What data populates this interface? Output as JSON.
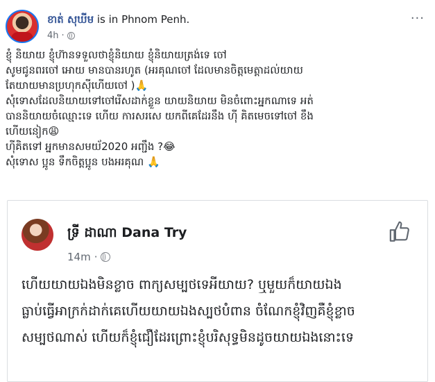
{
  "post": {
    "author": "ខាត់ សុឃីម",
    "author_suffix": " is in Phnom Penh.",
    "time": "4h",
    "time_separator": "·",
    "more": "···",
    "body_lines": [
      "ខ្ញុំ និយាយ ខ្ញុំហ៊ានទទួលថាខ្ញុំនិយាយ ខ្ញុំនិយាយត្រង់ទេ ចៅ",
      "សូមជូនពរចៅ អោយ មានបានរហូត (អរគុណចៅ ដែលមានចិត្តមេត្តាដល់យាយ",
      "តែយាយមានប្រហុកស៊ីហើយចៅ )🙏",
      "សុំទោសដែលនិយាយទៅចៅរើសដាក់ខ្លួន យាយនិយាយ មិនចំពោះអ្នកណាទេ អត់",
      "បាននិយាយចំឈ្មោះទេ ហើយ ការសរសេ យកពីគេដែរនឹង ហ៊ី គិតមេចទៅចៅ ខឹង",
      "ហើយនៀក😩",
      "ហ៊ីគិតទៅ អ្នកមានសមយ័2020 អញ្ជឹង ?😂",
      "សុំទោស ប្អូន ទឹកចិត្តប្អូន បងអរគុណ 🙏"
    ]
  },
  "shared": {
    "author": "ទ្រី ដាណា Dana Try",
    "time": "14m",
    "time_separator": "·",
    "lines": [
      "ហើយយាយឯងមិនខ្លាច ពាក្យសម្បថទេអីយាយ? ឬមួយក៏យាយឯង",
      "ធ្លាប់ធ្វើអាក្រក់ដាក់គេហើយយាយឯងស្បថបំពាន ចំណែកខ្ញុំវិញគឺខ្ញុំខ្លាច",
      "សម្បថណាស់ ហើយក៏ខ្ញុំជឿដែរព្រោះខ្ញុំបរិសុទ្ធមិនដូចយាយឯងនោះទេ"
    ]
  },
  "icons": {
    "more": "more-horizontal-icon",
    "globe": "globe-icon",
    "like": "thumbs-up-icon"
  },
  "colors": {
    "link": "#385898",
    "meta": "#606770",
    "border": "#dadde1",
    "accent": "#1877f2"
  }
}
